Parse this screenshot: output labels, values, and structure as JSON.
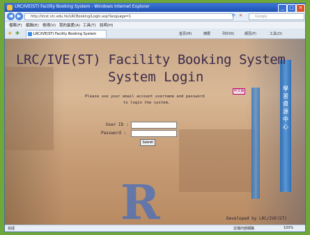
{
  "window": {
    "title": "LRC/IVE(ST) Facility Booking System - Windows Internet Explorer",
    "minimize": "_",
    "maximize": "□",
    "close": "×"
  },
  "browser": {
    "back": "◀",
    "forward": "▶",
    "url": "http://lrcst.vtc.edu.hk/LRCBooking/Login.asp?language=1",
    "search_placeholder": "Google",
    "menu": [
      "檔案(F)",
      "編輯(E)",
      "檢視(V)",
      "我的最愛(A)",
      "工具(T)",
      "說明(H)"
    ],
    "tab_label": "LRC/IVE(ST) Facility Booking System",
    "tools": [
      "首頁(M)",
      "摘要",
      "列印(R)",
      "網頁(P)",
      "工具(O)"
    ]
  },
  "page": {
    "title_line1": "LRC/IVE(ST) Facility Booking System",
    "title_line2": "System Login",
    "language_link": "中文版",
    "instruction_line1": "Please use your email account username and password",
    "instruction_line2": "to login the system.",
    "user_id_label": "User ID :",
    "password_label": "Password :",
    "submit_label": "Submit",
    "footer": "Developed by LRC/IVE(ST)",
    "pillar_text": "學習資源中心",
    "decor_letter": "R"
  },
  "status": {
    "left": "完成",
    "zone": "近端內部網路",
    "zoom": "100%"
  }
}
